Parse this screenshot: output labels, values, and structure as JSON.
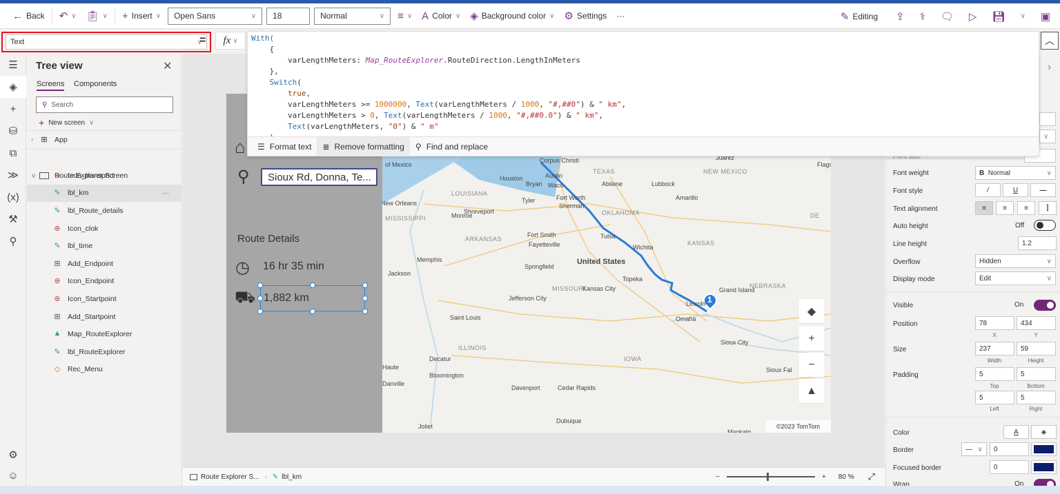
{
  "toolbar": {
    "back": "Back",
    "insert": "Insert",
    "font": "Open Sans",
    "font_size": "18",
    "font_weight": "Normal",
    "color": "Color",
    "background_color": "Background color",
    "settings": "Settings",
    "more": "···",
    "editing": "Editing"
  },
  "formula_bar": {
    "property": "Text",
    "equals": "=",
    "fx": "fx",
    "lines": [
      "With(",
      "    {",
      "        varLengthMeters: Map_RouteExplorer.RouteDirection.LengthInMeters",
      "    },",
      "    Switch(",
      "        true,",
      "        varLengthMeters >= 1000000, Text(varLengthMeters / 1000, \"#,##0\") & \" km\",",
      "        varLengthMeters > 0, Text(varLengthMeters / 1000, \"#,##0.0\") & \" km\",",
      "        Text(varLengthMeters, \"0\") & \" m\"",
      "    )"
    ],
    "format_text": "Format text",
    "remove_formatting": "Remove formatting",
    "find_replace": "Find and replace"
  },
  "tree": {
    "title": "Tree view",
    "tabs": [
      "Screens",
      "Components"
    ],
    "search_placeholder": "Search",
    "new_screen": "New screen",
    "app": "App",
    "screen": "Route Explorer Screen",
    "items": [
      {
        "label": "Icon_transport",
        "type": "icon"
      },
      {
        "label": "lbl_km",
        "type": "label",
        "selected": true
      },
      {
        "label": "lbl_Route_details",
        "type": "label"
      },
      {
        "label": "Icon_clok",
        "type": "icon"
      },
      {
        "label": "lbl_time",
        "type": "label"
      },
      {
        "label": "Add_Endpoint",
        "type": "input"
      },
      {
        "label": "Icon_Endpoint",
        "type": "icon"
      },
      {
        "label": "Icon_Startpoint",
        "type": "icon"
      },
      {
        "label": "Add_Startpoint",
        "type": "input"
      },
      {
        "label": "Map_RouteExplorer",
        "type": "map"
      },
      {
        "label": "lbl_RouteExplorer",
        "type": "label"
      },
      {
        "label": "Rec_Menu",
        "type": "rect"
      }
    ],
    "more": "···"
  },
  "app_screen": {
    "endpoint": "Sioux Rd, Donna, Te...",
    "route_details": "Route Details",
    "time": "16 hr 35 min",
    "distance": "1,882 km",
    "map": {
      "copyright": "©2023 TomTom",
      "pin": "1",
      "labels": [
        "Corpus Christi",
        "Juárez",
        "Flags",
        "Austin",
        "TEXAS",
        "NEW MEXICO",
        "Houston",
        "Bryan",
        "Waco",
        "Abilene",
        "Lubbock",
        "of Mexico",
        "LOUISIANA",
        "Tyler",
        "Fort Worth",
        "Sherman",
        "Amarillo",
        "New Orleans",
        "Shreveport",
        "MISSISSIPPI",
        "Monroe",
        "OKLAHOMA",
        "DE",
        "ARKANSAS",
        "Fort Smith",
        "Fayetteville",
        "Tulsa",
        "Memphis",
        "Wichita",
        "KANSAS",
        "Jackson",
        "Springfield",
        "United States",
        "Topeka",
        "MISSOURI",
        "Jefferson City",
        "Kansas City",
        "Grand Island",
        "NEBRASKA",
        "Lincoln",
        "Omaha",
        "Saint Louis",
        "ILLINOIS",
        "Sioux City",
        "Decatur",
        "Bloomington",
        "IOWA",
        "Haute",
        "Danville",
        "Davenport",
        "Cedar Rapids",
        "Sioux Fal",
        "Dubuque",
        "Joliet",
        "Mankato"
      ]
    }
  },
  "properties": {
    "font_size": "Font size",
    "font_weight_label": "Font weight",
    "font_weight": "Normal",
    "font_style": "Font style",
    "text_alignment": "Text alignment",
    "auto_height": "Auto height",
    "auto_height_value": "Off",
    "line_height": "Line height",
    "line_height_value": "1.2",
    "overflow": "Overflow",
    "overflow_value": "Hidden",
    "display_mode": "Display mode",
    "display_mode_value": "Edit",
    "visible": "Visible",
    "visible_value": "On",
    "position": "Position",
    "x": "78",
    "y": "434",
    "x_label": "X",
    "y_label": "Y",
    "size": "Size",
    "width": "237",
    "height": "59",
    "width_label": "Width",
    "height_label": "Height",
    "padding": "Padding",
    "pad_top": "5",
    "pad_bottom": "5",
    "pad_left": "5",
    "pad_right": "5",
    "top_label": "Top",
    "bottom_label": "Bottom",
    "left_label": "Left",
    "right_label": "Right",
    "color": "Color",
    "border": "Border",
    "border_value": "0",
    "focused_border": "Focused border",
    "focused_border_value": "0",
    "wrap": "Wrap",
    "wrap_value": "On",
    "border_color": "#0b1e6b"
  },
  "status": {
    "screen": "Route Explorer S...",
    "control": "lbl_km",
    "zoom": "80",
    "zoom_unit": "%",
    "zoom_level": 0.45
  },
  "colors": {
    "accent": "#742774",
    "selection": "#2b88d8",
    "highlight": "#e81123",
    "route": "#2b7bd8"
  }
}
